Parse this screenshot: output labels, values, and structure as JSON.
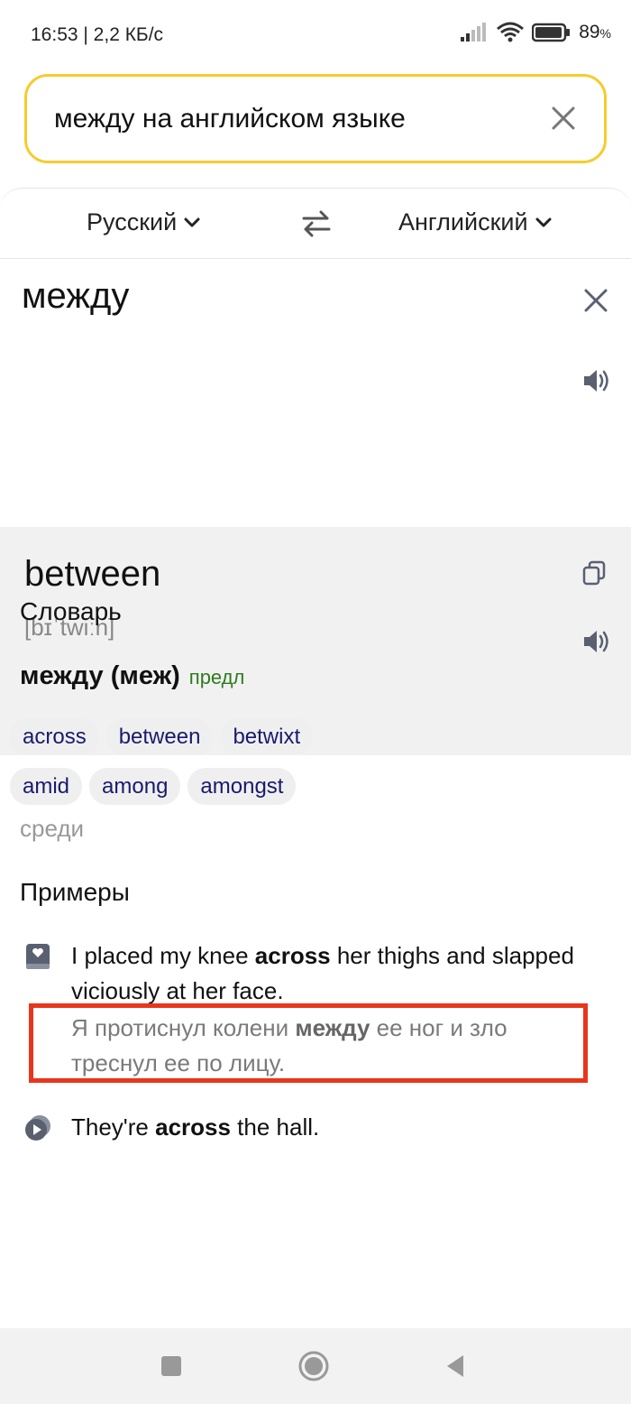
{
  "status_bar": {
    "time_speed": "16:53 | 2,2 КБ/с",
    "battery": "89",
    "battery_unit": "%"
  },
  "search": {
    "query": "между на английском языке"
  },
  "translator": {
    "source_lang": "Русский",
    "target_lang": "Английский",
    "source_text": "между",
    "result_text": "between",
    "transcription": "[bɪˈtwiːn]"
  },
  "dictionary": {
    "heading": "Словарь",
    "entry_word": "между (меж)",
    "part_of_speech": "предл",
    "chips_row1": [
      "across",
      "between",
      "betwixt"
    ],
    "chips_row2": [
      "amid",
      "among",
      "amongst"
    ],
    "note": "среди"
  },
  "examples": {
    "heading": "Примеры",
    "items": [
      {
        "en_before": "I placed my knee ",
        "en_bold": "across",
        "en_after": " her thighs and slapped viciously at her face.",
        "ru_before": "Я протиснул колени ",
        "ru_bold": "между",
        "ru_after": " ее ног и зло треснул ее по лицу."
      },
      {
        "en_before": "They're ",
        "en_bold": "across",
        "en_after": " the hall."
      }
    ]
  },
  "colors": {
    "search_border": "#f6cc2c",
    "highlight": "#e8351c",
    "pos": "#2f7a1f",
    "chip_text": "#1a1a6e"
  }
}
